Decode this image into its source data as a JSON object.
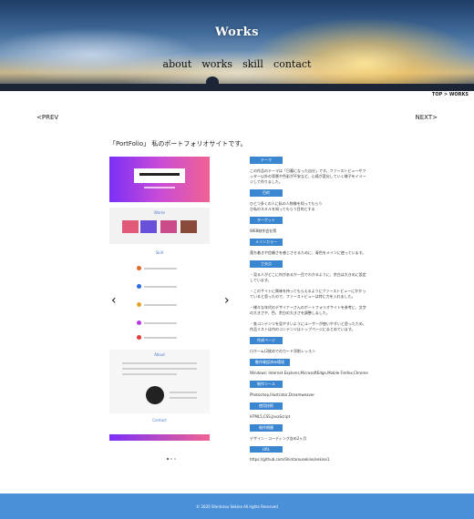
{
  "header": {
    "title": "Works",
    "nav": [
      "about",
      "works",
      "skill",
      "contact"
    ]
  },
  "breadcrumb": "TOP > WORKS",
  "pager": {
    "prev": "<PREV",
    "next": "NEXT>"
  },
  "heading": "「PortFolio」 私のポートフォリオサイトです。",
  "slider": {
    "panel_works_title": "Works",
    "panel_skill_title": "Skill",
    "panel_about_title": "About",
    "panel_contact_title": "Contact",
    "prev_arrow": "‹",
    "next_arrow": "›",
    "dots": 3,
    "active_dot": 0
  },
  "details": [
    {
      "label": "テーマ",
      "text": "この作品のテーマは「日暮になった自分」です。ファーストビューやフッター以外の背景や色彩が不安など、心境が変化していく様子をイメージして作りました。"
    },
    {
      "label": "目的",
      "text": "ひとつ多くの人に私の人物像を知ってもらう\nひ私のスキルを知ってもらう目的とする"
    },
    {
      "label": "ターゲット",
      "text": "WEB制作会社等"
    },
    {
      "label": "メインカラー",
      "text": "落ち着きや信頼さを感じさせるために、青色をメインに使っています。"
    },
    {
      "label": "工夫点",
      "text": "・見る人がどこに何があるか一目でわかるように、余白は大きめに設定しています。\n\n・このサイトに興味を持ってもらえるようにファーストビューにかかっていると思ったので、ファーストビューは特に力を入れました。\n\n・様々な年代のデザイナーさんのポートフォリオサイトを参考に、文字の大きさや、色、余白の大きさを調整しました。\n\n・各コンテンツを見やすいようにユーザーが使いやすいと思ったため、作品リストは内のコンテンツはトップページにまとめています。"
    },
    {
      "label": "作成ページ",
      "text": "ロホーム(2枚めでのカード添削レッスン"
    },
    {
      "label": "動作確認済み環境",
      "text": "Windows: Internet Explorer,MicrosoftEdge,Mobile Firefox,Chrome"
    },
    {
      "label": "制作ツール",
      "text": "Photoshop,Illustrator,Dreamweaver"
    },
    {
      "label": "使用技術",
      "text": "HTML5,CSS,JavaScript"
    },
    {
      "label": "制作期間",
      "text": "デザイン・コーディング含め2ヶ月"
    },
    {
      "label": "URL",
      "text": "https://github.com/Shintarousekine/sekine1"
    }
  ],
  "footer": "©  2020 Shintarou Sekine All rights Reserved",
  "colors": {
    "accent": "#3a86d1",
    "footer": "#4a90d9"
  }
}
